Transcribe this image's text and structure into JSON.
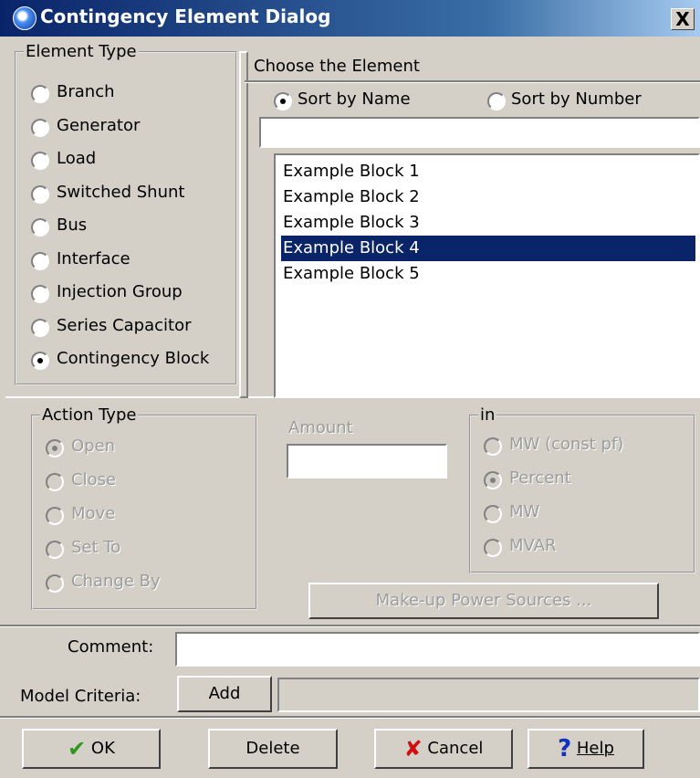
{
  "window": {
    "title": "Contingency Element Dialog",
    "close_label": "X"
  },
  "element_type": {
    "label": "Element Type",
    "options": [
      "Branch",
      "Generator",
      "Load",
      "Switched Shunt",
      "Bus",
      "Interface",
      "Injection Group",
      "Series Capacitor",
      "Contingency Block"
    ],
    "selected": "Contingency Block"
  },
  "choose": {
    "label": "Choose the Element",
    "sort_name": "Sort by Name",
    "sort_number": "Sort by Number",
    "sort_selected": "Sort by Name",
    "filter_value": "",
    "items": [
      "Example Block 1",
      "Example Block 2",
      "Example Block 3",
      "Example Block 4",
      "Example Block 5"
    ],
    "selected_item": "Example Block 4"
  },
  "action_type": {
    "label": "Action Type",
    "options": [
      "Open",
      "Close",
      "Move",
      "Set To",
      "Change By"
    ],
    "selected": "Open"
  },
  "amount": {
    "label": "Amount",
    "value": ""
  },
  "in_group": {
    "label": "in",
    "options": [
      "MW (const pf)",
      "Percent",
      "MW",
      "MVAR"
    ],
    "selected": "Percent"
  },
  "makeup_button": "Make-up Power Sources ...",
  "comment": {
    "label": "Comment:",
    "value": ""
  },
  "model_criteria": {
    "label": "Model Criteria:",
    "add_label": "Add",
    "value": ""
  },
  "buttons": {
    "ok": "OK",
    "delete": "Delete",
    "cancel": "Cancel",
    "help": "Help"
  },
  "colors": {
    "title_bar": "#0a246a",
    "selection": "#0a246a",
    "face": "#d4d0c8"
  }
}
